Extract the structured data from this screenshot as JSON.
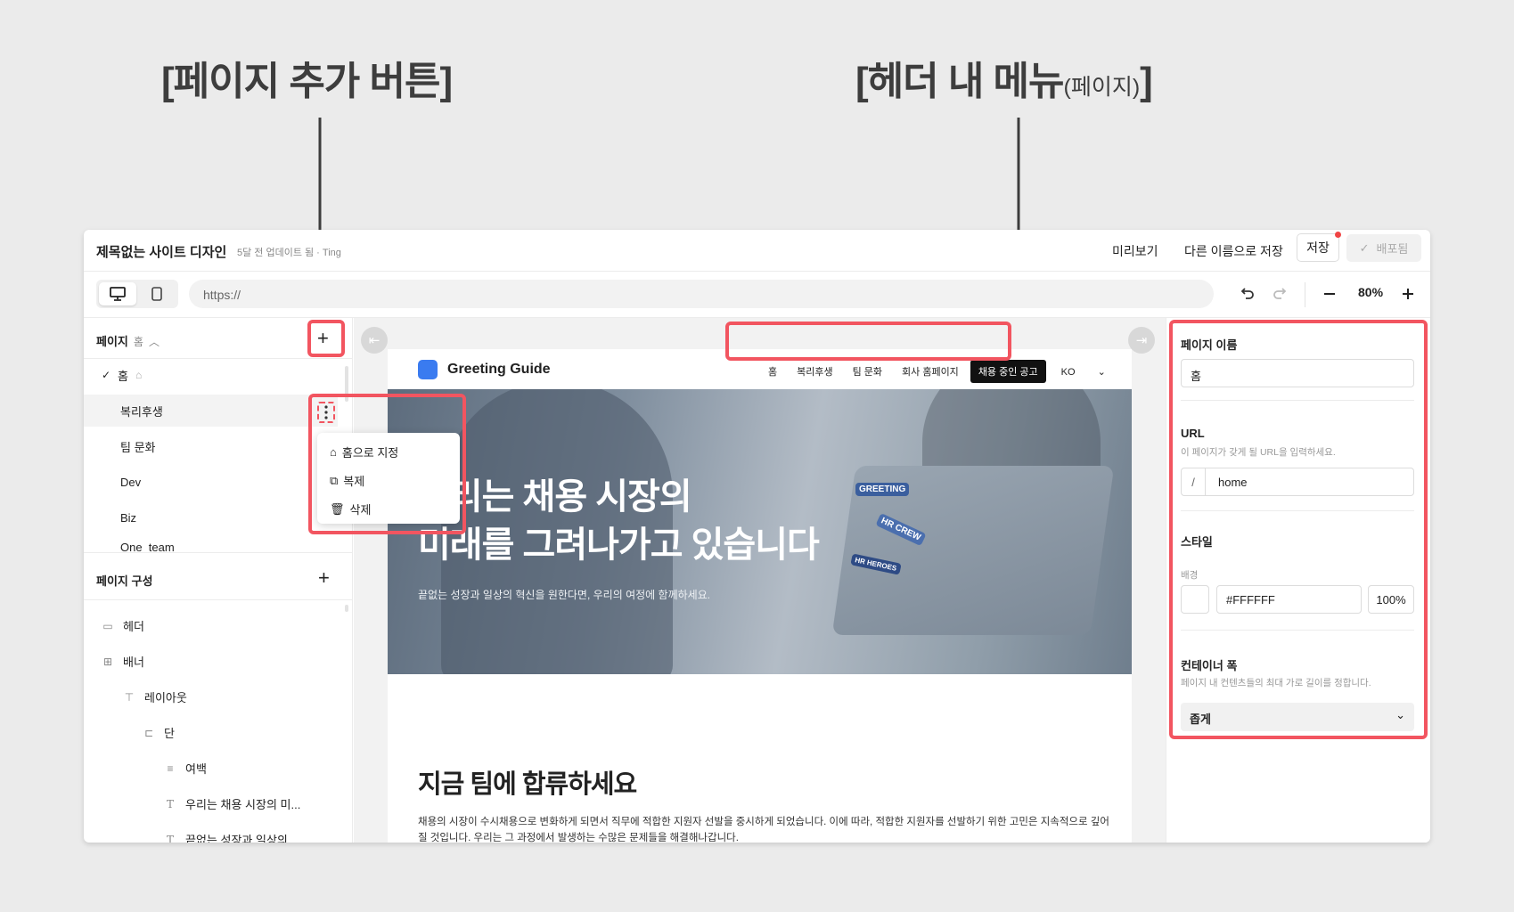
{
  "annotations": {
    "add_page_button": "[페이지 추가 버튼]",
    "header_menu_main": "[헤더 내 메뉴",
    "header_menu_small": "(페이지)",
    "header_menu_close": "]"
  },
  "titlebar": {
    "title": "제목없는 사이트 디자인",
    "meta": "5달 전 업데이트 됨 · Ting",
    "preview": "미리보기",
    "save_as": "다른 이름으로 저장",
    "save": "저장",
    "deploy": "배포됨"
  },
  "toolbar": {
    "url_placeholder": "https://",
    "zoom": "80%"
  },
  "pages": {
    "header": "페이지",
    "current": "홈",
    "items": [
      "홈",
      "복리후생",
      "팀 문화",
      "Dev",
      "Biz",
      "One_team"
    ]
  },
  "context_menu": [
    "홈으로 지정",
    "복제",
    "삭제"
  ],
  "structure": {
    "header": "페이지 구성",
    "items": [
      "헤더",
      "배너",
      "레이아웃",
      "단",
      "여백",
      "우리는 채용 시장의 미...",
      "끝없는 성장과 일상의 ..."
    ]
  },
  "site": {
    "title": "Greeting Guide",
    "nav": [
      "홈",
      "복리후생",
      "팀 문화",
      "회사 홈페이지",
      "채용 중인 공고"
    ],
    "lang": "KO",
    "hero_line1": "우리는 채용 시장의",
    "hero_line2": "미래를 그려나가고 있습니다",
    "hero_sub": "끝없는 성장과 일상의 혁신을 원한다면, 우리의 여정에 함께하세요.",
    "stickers": [
      "GREETING",
      "HR CREW",
      "HR HEROES"
    ],
    "section_title": "지금 팀에 합류하세요",
    "paragraph": "채용의 시장이 수시채용으로 변화하게 되면서 직무에 적합한 지원자 선발을 중시하게 되었습니다. 이에 따라, 적합한 지원자를 선발하기 위한 고민은 지속적으로 깊어질 것입니다. 우리는 그 과정에서 발생하는 수많은 문제들을 해결해나갑니다."
  },
  "settings": {
    "page_name_label": "페이지 이름",
    "page_name_value": "홈",
    "url_label": "URL",
    "url_hint": "이 페이지가 갖게 될 URL을 입력하세요.",
    "url_prefix": "/",
    "url_value": "home",
    "style_label": "스타일",
    "bg_label": "배경",
    "bg_color": "#FFFFFF",
    "bg_opacity": "100%",
    "width_label": "컨테이너 폭",
    "width_hint": "페이지 내 컨텐츠들의 최대 가로 길이를 정합니다.",
    "width_value": "좁게"
  },
  "colors": {
    "highlight": "#f25560",
    "logo": "#3a7bf0"
  }
}
